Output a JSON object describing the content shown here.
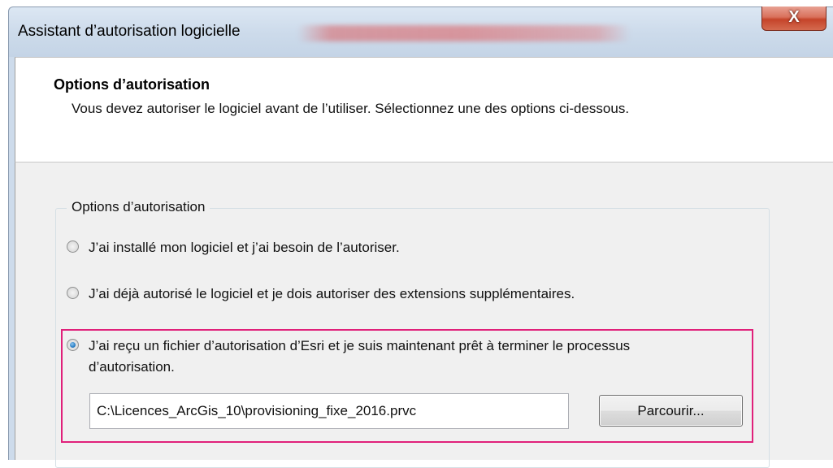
{
  "window": {
    "title": "Assistant d’autorisation logicielle",
    "close_label": "X"
  },
  "header": {
    "title": "Options d’autorisation",
    "description": "Vous devez autoriser le logiciel avant de l’utiliser. Sélectionnez une des options ci-dessous."
  },
  "group": {
    "legend": "Options d’autorisation",
    "options": [
      {
        "label": "J’ai installé mon logiciel et j’ai besoin de l’autoriser.",
        "selected": false
      },
      {
        "label": "J’ai déjà autorisé le logiciel et je dois autoriser des extensions supplémentaires.",
        "selected": false
      },
      {
        "label": "J’ai reçu un fichier d’autorisation d’Esri et je suis maintenant prêt à terminer le processus d’autorisation.",
        "selected": true
      }
    ],
    "file_path": "C:\\Licences_ArcGis_10\\provisioning_fixe_2016.prvc",
    "browse_label": "Parcourir..."
  },
  "colors": {
    "highlight": "#e0207a",
    "radio_selected": "#2a7fc6"
  }
}
